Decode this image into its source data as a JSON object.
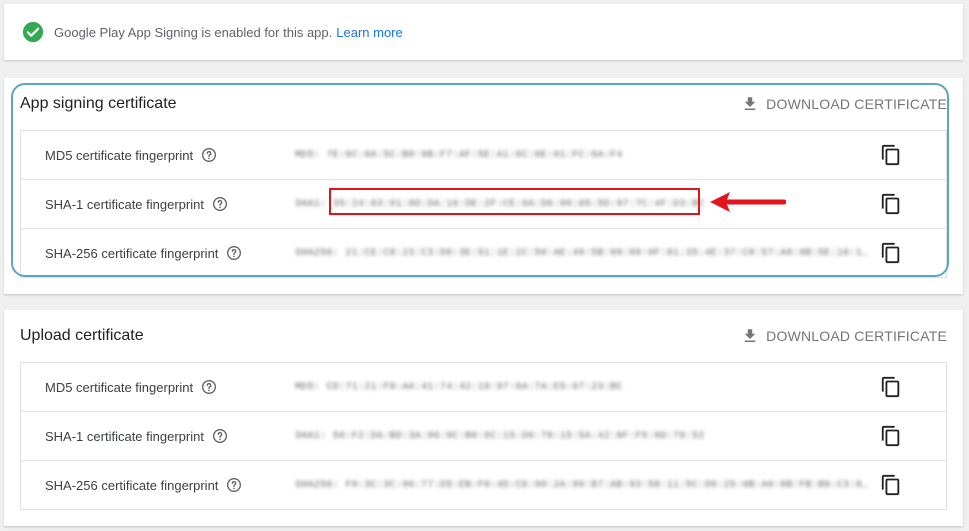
{
  "banner": {
    "text": "Google Play App Signing is enabled for this app.",
    "link": "Learn more"
  },
  "colors": {
    "accent": "#1a73e8",
    "success": "#34a853",
    "highlight": "#e0161c",
    "ring": "#5aa6c6"
  },
  "sections": [
    {
      "title": "App signing certificate",
      "download_label": "DOWNLOAD CERTIFICATE",
      "rows": [
        {
          "label": "MD5 certificate fingerprint",
          "value": "MD5: 7E:6C:8A:5C:B0:9B:F7:AF:5E:A1:6C:0E:01:FC:6A:F4"
        },
        {
          "label": "SHA-1 certificate fingerprint",
          "value": "SHA1: 35:24:63:01:8D:DA:16:DE:2F:CE:6A:D6:90:85:5D:97:7C:4F:D3:BC"
        },
        {
          "label": "SHA-256 certificate fingerprint",
          "value": "SHA256: 21:CE:C8:23:C3:D6:3E:51:1E:2C:50:AE:49:5B:98:09:0F:01:35:4E:37:C8:57:A0:8B:5E:16:1A..."
        }
      ]
    },
    {
      "title": "Upload certificate",
      "download_label": "DOWNLOAD CERTIFICATE",
      "rows": [
        {
          "label": "MD5 certificate fingerprint",
          "value": "MD5: CD:71:21:F8:AA:41:74:42:19:97:6A:7A:E5:67:23:BC"
        },
        {
          "label": "SHA-1 certificate fingerprint",
          "value": "SHA1: 56:F2:DA:BD:3A:06:0C:B0:6C:15:D6:78:15:5A:42:8F:F5:0D:78:52"
        },
        {
          "label": "SHA-256 certificate fingerprint",
          "value": "SHA256: F0:3C:3C:96:77:D5:EB:F0:4D:CD:90:2A:99:B7:AB:93:58:11:5C:D0:25:0B:A0:8B:FB:B0:C3:0..."
        }
      ]
    }
  ],
  "icons": {
    "check": "check-circle-icon",
    "download": "download-icon",
    "help": "help-circle-icon",
    "copy": "copy-icon",
    "arrow": "red-arrow-icon"
  }
}
